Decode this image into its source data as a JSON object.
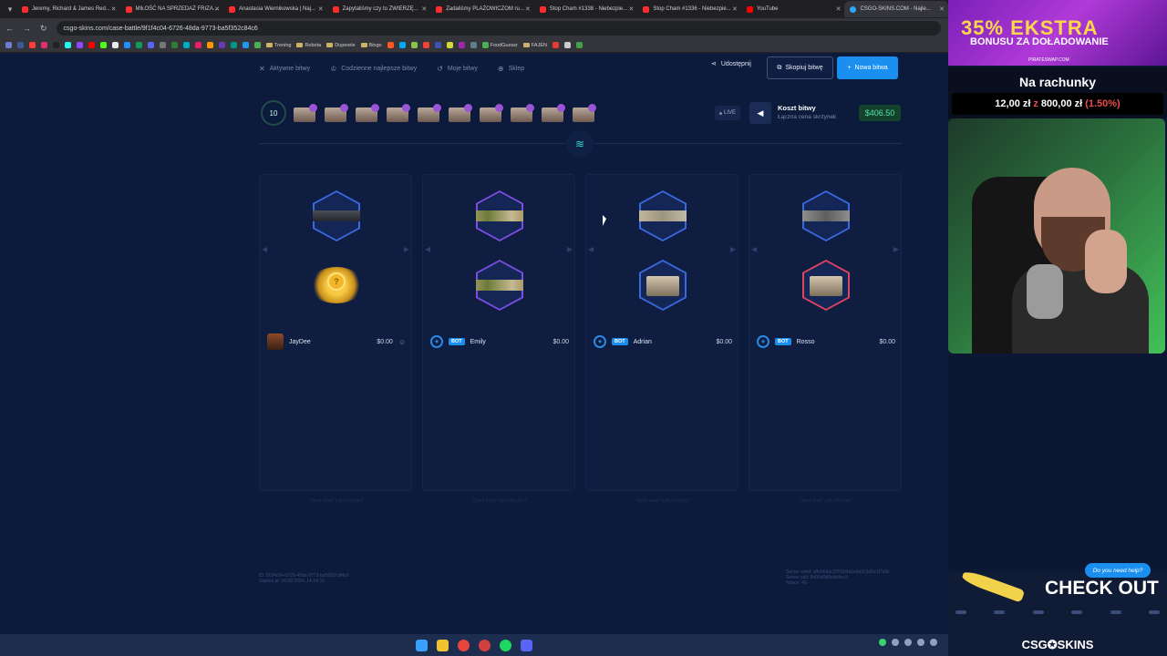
{
  "browser": {
    "tabs": [
      {
        "title": "Jeremy, Richard & James Red..."
      },
      {
        "title": "MIŁOŚĆ NA SPRZEDAŻ FRIZA..."
      },
      {
        "title": "Anastasia Wiernikowska | Naj..."
      },
      {
        "title": "Zapytaliśmy czy to ZWIERZĘ..."
      },
      {
        "title": "Zadaliśmy PLAŻOWICZOM ru..."
      },
      {
        "title": "Stop Cham #1338 - Niebezpie..."
      },
      {
        "title": "Stop Cham #1336 - Niebezpie..."
      },
      {
        "title": "YouTube"
      },
      {
        "title": "CSGO-SKINS.COM - Najle..."
      }
    ],
    "url": "csgo-skins.com/case-battle/9f1f4c04-6726-48da-9773-ba5f352c84c6",
    "bookmarks": [
      "Trening",
      "Robota",
      "Duperele",
      "Bingo",
      "FoodGuessr",
      "FAJEN"
    ]
  },
  "subnav": {
    "active_battles": "Aktywne bitwy",
    "daily_best": "Codzienne najlepsze bitwy",
    "my_battles": "Moje bitwy",
    "shop": "Sklep",
    "share": "Udostępnij",
    "copy_battle": "Skopiuj bitwę",
    "new_battle": "Nowa bitwa"
  },
  "battle": {
    "round": "10",
    "live": "LIVE",
    "cost_title": "Koszt bitwy",
    "cost_sub": "Łączna cena skrzynek",
    "cost_value": "$406.50",
    "case_count": 10
  },
  "players": [
    {
      "name": "JayDee",
      "amount": "$0.00",
      "bot": false,
      "seed": "Client seed: 1d4c1f0e2ac7"
    },
    {
      "name": "Emily",
      "amount": "$0.00",
      "bot": true,
      "bot_label": "BOT",
      "seed": "Client seed: 1d4c1f0e2ac7"
    },
    {
      "name": "Adrian",
      "amount": "$0.00",
      "bot": true,
      "bot_label": "BOT",
      "seed": "Client seed: 1d4c1f0e2ac7"
    },
    {
      "name": "Rosso",
      "amount": "$0.00",
      "bot": true,
      "bot_label": "BOT",
      "seed": "Client seed: 1d4c1f0e2ac7"
    }
  ],
  "footer": {
    "left_l1": "ID: 9f1f4c04-6726-48da-9773-ba5f352c84c6",
    "left_l2": "Started at: 26.08.2024, 14:14:33",
    "right_l1": "Server seed: a8e5b6ac2f7f1b4a1e0a3c5d2e1f7a9c",
    "right_l2": "Server salt: 8a09d0d9ebd4cc3",
    "right_l3": "Nonce: 40"
  },
  "help": "Do you need help?",
  "sidebar": {
    "promo_l1": "35% EKSTRA",
    "promo_l2": "BONUSU ZA DOŁADOWANIE",
    "promo_l3": "PIRATESWAP.COM",
    "donate_title": "Na rachunky",
    "donate_current": "12,00 zł",
    "donate_sep": "z",
    "donate_goal": "800,00 zł",
    "donate_pct": "(1.50%)",
    "checkout": "CHECK OUT",
    "brand": "CSG✪SKINS"
  }
}
